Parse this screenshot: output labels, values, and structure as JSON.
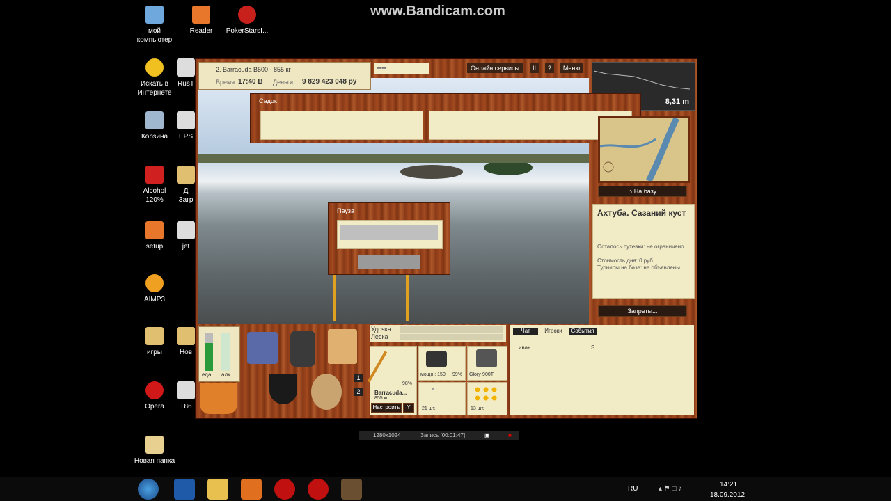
{
  "watermark": "www.Bandicam.com",
  "desktop": {
    "icons": [
      {
        "label": "мой\nкомпьютер"
      },
      {
        "label": "Reader"
      },
      {
        "label": "PokerStarsI..."
      },
      {
        "label": "Искать в\nИнтернете"
      },
      {
        "label": "RusT"
      },
      {
        "label": "Корзина"
      },
      {
        "label": "EPS"
      },
      {
        "label": "Alcohol\n120%"
      },
      {
        "label": "Д\nЗагр"
      },
      {
        "label": "setup"
      },
      {
        "label": "jet"
      },
      {
        "label": "AIMP3"
      },
      {
        "label": "игры"
      },
      {
        "label": "Нов"
      },
      {
        "label": "Opera"
      },
      {
        "label": "T86"
      },
      {
        "label": "Новая папка"
      }
    ]
  },
  "game": {
    "top_info": {
      "title": "2. Barracuda B500 - 855 кг",
      "time_label": "Время",
      "time_value": "17:40 В",
      "money_label": "Деньги",
      "money_value": "9 829 423 048 ру"
    },
    "menu": {
      "online_label": "Онлайн сервисы",
      "pause_btn": "II",
      "help_btn": "?",
      "menu_label": "Меню"
    },
    "depth": "8,31 m",
    "sadok_label": "Садок",
    "pause_label": "Пауза",
    "to_base_label": "На базу",
    "location": {
      "title": "Ахтуба. Сазаний куст",
      "line1": "Осталось путевки: не ограничено",
      "line2": "Стоимость дня: 0 руб",
      "line3": "Турниры на базе: не объявлены"
    },
    "prohibitions_label": "Запреты...",
    "bars": {
      "food_label": "еда",
      "alc_label": "алк"
    },
    "slot_numbers": [
      "1",
      "2"
    ],
    "tackle": {
      "rod_label": "Удочка",
      "line_label": "Леска",
      "rod_name": "Barracuda...",
      "rod_weight": "855 кг",
      "rod_percent": "98%",
      "reel_power_label": "мощн.: 150",
      "reel_percent": "99%",
      "line_name": "Glory-900Ti",
      "hooks_count": "21 шт.",
      "bait_count": "13 шт.",
      "configure_label": "Настроить",
      "configure_arrow": "Y"
    },
    "chat": {
      "tabs": [
        "Чат",
        "Игроки",
        "События"
      ],
      "rows": [
        {
          "name": "иван",
          "value": "S..."
        }
      ]
    }
  },
  "recorder": {
    "resolution": "1280x1024",
    "record_label": "Запись [00:01:47]"
  },
  "taskbar": {
    "lang": "RU",
    "time": "14:21",
    "date": "18.09.2012"
  },
  "colors": {
    "wood": "#8a3a18",
    "cream": "#f1ebc6",
    "dark_button": "#2b1a12"
  }
}
